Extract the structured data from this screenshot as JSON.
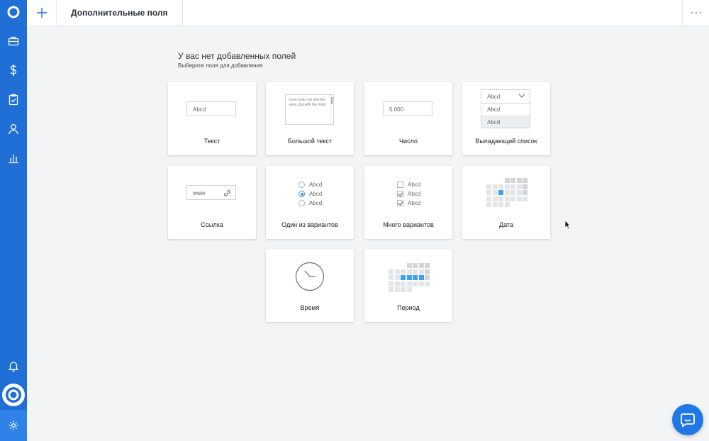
{
  "header": {
    "title": "Дополнительные поля"
  },
  "empty_state": {
    "title": "У вас нет добавленных полей",
    "subtitle": "Выберите поля для добавления"
  },
  "fields": {
    "text": {
      "label": "Текст",
      "preview": "Abcd"
    },
    "long_text": {
      "label": "Большой текст",
      "preview": "Love looks not with the eyes, but with the mind."
    },
    "number": {
      "label": "Число",
      "preview": "5 000"
    },
    "dropdown": {
      "label": "Выпадающий список",
      "preview_selected": "Abcd",
      "preview_options": [
        "Abcd",
        "Abcd"
      ]
    },
    "link": {
      "label": "Ссылка",
      "preview": "www"
    },
    "single_choice": {
      "label": "Один из вариантов",
      "options": [
        "Abcd",
        "Abcd",
        "Abcd"
      ],
      "selected_index": 1
    },
    "multi_choice": {
      "label": "Много вариантов",
      "options": [
        "Abcd",
        "Abcd",
        "Abcd"
      ],
      "checked": [
        false,
        true,
        true
      ]
    },
    "date": {
      "label": "Дата"
    },
    "time": {
      "label": "Время"
    },
    "period": {
      "label": "Период"
    }
  },
  "sidebar": {
    "items": [
      {
        "icon": "briefcase-icon"
      },
      {
        "icon": "dollar-icon"
      },
      {
        "icon": "clipboard-check-icon"
      },
      {
        "icon": "user-icon"
      },
      {
        "icon": "bar-chart-icon"
      }
    ],
    "bottom": [
      {
        "icon": "bell-icon"
      },
      {
        "icon": "avatar"
      },
      {
        "icon": "gear-icon"
      }
    ]
  },
  "colors": {
    "sidebar": "#1f6fd6",
    "accent": "#3fa0ee",
    "chat": "#1f78e5"
  }
}
